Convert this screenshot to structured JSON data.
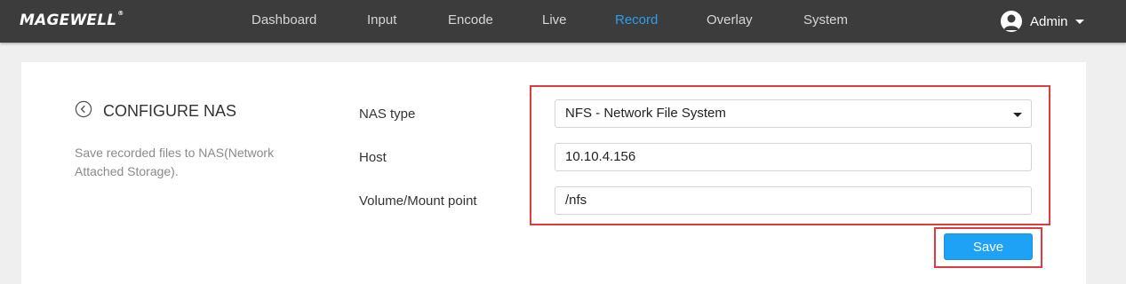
{
  "header": {
    "logo": "MAGEWELL",
    "logo_mark": "®",
    "nav": [
      {
        "label": "Dashboard"
      },
      {
        "label": "Input"
      },
      {
        "label": "Encode"
      },
      {
        "label": "Live"
      },
      {
        "label": "Record",
        "active": true
      },
      {
        "label": "Overlay"
      },
      {
        "label": "System"
      }
    ],
    "user": {
      "name": "Admin",
      "icon": "user-avatar-icon"
    }
  },
  "section": {
    "title": "CONFIGURE NAS",
    "description": "Save recorded files to NAS(Network Attached Storage).",
    "back_icon": "back-circle-icon"
  },
  "form": {
    "nas_type": {
      "label": "NAS type",
      "value": "NFS - Network File System"
    },
    "host": {
      "label": "Host",
      "value": "10.10.4.156"
    },
    "mount_point": {
      "label": "Volume/Mount point",
      "value": "/nfs"
    },
    "save_label": "Save"
  },
  "colors": {
    "topbar": "#3c3c3c",
    "active_nav": "#2e9cf0",
    "save_button": "#1ea2f5",
    "highlight": "#e23a3f"
  }
}
